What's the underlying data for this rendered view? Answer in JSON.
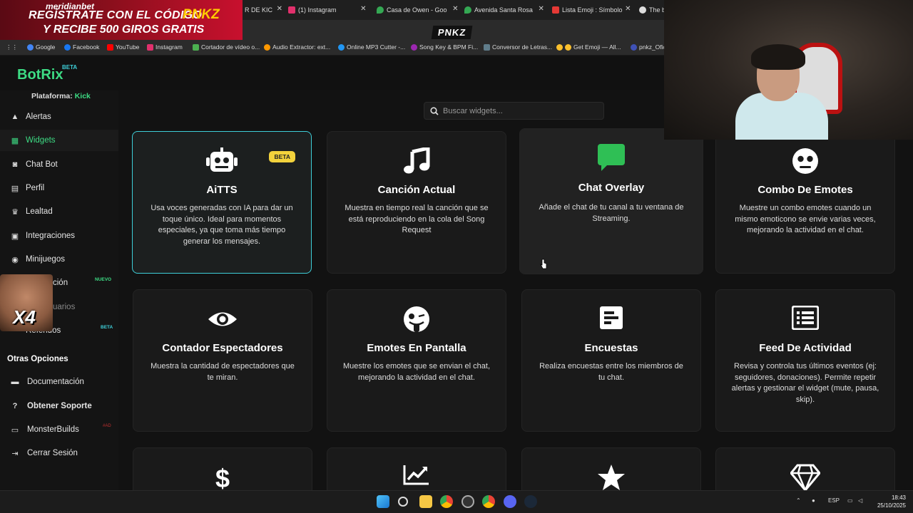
{
  "ad": {
    "brand": "meridianbet",
    "line1": "REGÍSTRATE CON EL CÓDIGO",
    "code": "PNKZ",
    "line2": "Y RECIBE 500 GIROS GRATIS"
  },
  "tabs": [
    {
      "label": "R DE KIC",
      "color": "#c03030"
    },
    {
      "label": "(1) Instagram",
      "color": "#e1306c"
    },
    {
      "label": "Casa de Owen - Goo",
      "color": "#34a853"
    },
    {
      "label": "Avenida Santa Rosa",
      "color": "#34a853"
    },
    {
      "label": "Lista Emoji : Símbolo",
      "color": "#e53935"
    },
    {
      "label": "The be",
      "color": "#dddddd"
    }
  ],
  "toolbar_brand": "PNKZ",
  "bookmarks": [
    {
      "label": "Google",
      "color": "#4285f4"
    },
    {
      "label": "Facebook",
      "color": "#1877f2"
    },
    {
      "label": "YouTube",
      "color": "#ff0000"
    },
    {
      "label": "Instagram",
      "color": "#e1306c"
    },
    {
      "label": "Cortador de vídeo o...",
      "color": "#4caf50"
    },
    {
      "label": "Audio Extractor: ext...",
      "color": "#ff9800"
    },
    {
      "label": "Online MP3 Cutter -...",
      "color": "#2196f3"
    },
    {
      "label": "Song Key & BPM Fi...",
      "color": "#9c27b0"
    },
    {
      "label": "Conversor de Letras...",
      "color": "#607d8b"
    },
    {
      "label": "Get Emoji — All...",
      "color": "#fbc02d"
    },
    {
      "label": "pnkz_Ofic",
      "color": "#3f51b5"
    }
  ],
  "logo": {
    "name": "BotRix",
    "beta": "BETA"
  },
  "platform": {
    "label": "Plataforma:",
    "value": "Kick"
  },
  "nav": [
    {
      "label": "Alertas",
      "icon": "warning-icon"
    },
    {
      "label": "Widgets",
      "icon": "grid-icon"
    },
    {
      "label": "Chat Bot",
      "icon": "robot-icon"
    },
    {
      "label": "Perfil",
      "icon": "id-card-icon"
    },
    {
      "label": "Lealtad",
      "icon": "trophy-icon"
    },
    {
      "label": "Integraciones",
      "icon": "plug-icon"
    },
    {
      "label": "Minijuegos",
      "icon": "gamepad-icon"
    },
    {
      "label": "ción",
      "icon": "bolt-icon"
    },
    {
      "label": "uarios",
      "icon": "users-icon"
    },
    {
      "label": "Referidos",
      "icon": "share-icon"
    }
  ],
  "badges": {
    "nuevo": "NUEVO",
    "beta": "BETA",
    "red": "#AD"
  },
  "emote_overlay": "X4",
  "others": {
    "title": "Otras Opciones",
    "items": [
      {
        "label": "Documentación",
        "icon": "book-icon"
      },
      {
        "label": "Obtener Soporte",
        "icon": "help-icon"
      },
      {
        "label": "MonsterBuilds",
        "icon": "monitor-icon"
      },
      {
        "label": "Cerrar Sesión",
        "icon": "logout-icon"
      }
    ]
  },
  "search": {
    "placeholder": "Buscar widgets..."
  },
  "widgets": [
    {
      "title": "AiTTS",
      "icon": "robot-icon",
      "desc": "Usa voces generadas con IA para dar un toque único. Ideal para momentos especiales, ya que toma más tiempo generar los mensajes.",
      "badge": "BETA"
    },
    {
      "title": "Canción Actual",
      "icon": "music-icon",
      "desc": "Muestra en tiempo real la canción que se está reproduciendo en la cola del Song Request"
    },
    {
      "title": "Chat Overlay",
      "icon": "chat-icon",
      "desc": "Añade el chat de tu canal a tu ventana de Streaming."
    },
    {
      "title": "Combo De Emotes",
      "icon": "emoji-icon",
      "desc": "Muestre un combo emotes cuando un mismo emoticono se envie varias veces, mejorando la actividad en el chat."
    },
    {
      "title": "Contador Espectadores",
      "icon": "eye-icon",
      "desc": "Muestra la cantidad de espectadores que te miran."
    },
    {
      "title": "Emotes En Pantalla",
      "icon": "tongue-icon",
      "desc": "Muestre los emotes que se envian el chat, mejorando la actividad en el chat."
    },
    {
      "title": "Encuestas",
      "icon": "poll-icon",
      "desc": "Realiza encuestas entre los miembros de tu chat."
    },
    {
      "title": "Feed De Actividad",
      "icon": "list-icon",
      "desc": "Revisa y controla tus últimos eventos (ej: seguidores, donaciones). Permite repetir alertas y gestionar el widget (mute, pausa, skip)."
    },
    {
      "title": "",
      "icon": "dollar-icon",
      "desc": ""
    },
    {
      "title": "",
      "icon": "chart-icon",
      "desc": ""
    },
    {
      "title": "",
      "icon": "star-icon",
      "desc": ""
    },
    {
      "title": "",
      "icon": "diamond-icon",
      "desc": ""
    }
  ],
  "tray": {
    "lang": "ESP",
    "time": "18:43",
    "date": "25/10/2025"
  },
  "colors": {
    "accent": "#3ddc84",
    "selected_border": "#3ecfd9",
    "beta_pill": "#f2d23c",
    "chat_green": "#2fbf55"
  }
}
